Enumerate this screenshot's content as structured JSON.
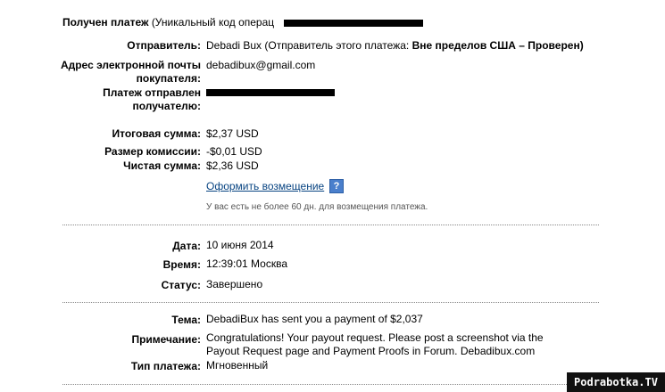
{
  "header": {
    "title": "Получен платеж",
    "subtitle": "(Уникальный код операц"
  },
  "payment": {
    "sender_label": "Отправитель:",
    "sender_value": "Debadi Bux (Отправитель этого платежа:",
    "sender_status": "Вне пределов США – Проверен)",
    "email_label_1": "Адрес электронной почты",
    "email_label_2": "покупателя:",
    "email_value": "debadibux@gmail.com",
    "sent_to_label_1": "Платеж отправлен",
    "sent_to_label_2": "получателю:",
    "total_label": "Итоговая сумма:",
    "total_value": "$2,37 USD",
    "fee_label": "Размер комиссии:",
    "fee_value": "-$0,01 USD",
    "net_label": "Чистая сумма:",
    "net_value": "$2,36 USD",
    "refund_link": "Оформить возмещение",
    "help_icon": "?",
    "refund_note": "У вас есть не более 60 дн. для возмещения платежа."
  },
  "details": {
    "date_label": "Дата:",
    "date_value": "10 июня 2014",
    "time_label": "Время:",
    "time_value": "12:39:01 Москва",
    "status_label": "Статус:",
    "status_value": "Завершено"
  },
  "message": {
    "subject_label": "Тема:",
    "subject_value": "DebadiBux has sent you a payment of $2,037",
    "note_label": "Примечание:",
    "note_line_1": "Congratulations! Your payout request. Please post a screenshot via the",
    "note_line_2": "Payout Request page and Payment Proofs in Forum. Debadibux.com",
    "type_label": "Тип платежа:",
    "type_value": "Мгновенный"
  },
  "watermark": "Podrabotka.TV",
  "colors": {
    "link": "#084482",
    "help_icon_bg": "#4a7fcc"
  }
}
